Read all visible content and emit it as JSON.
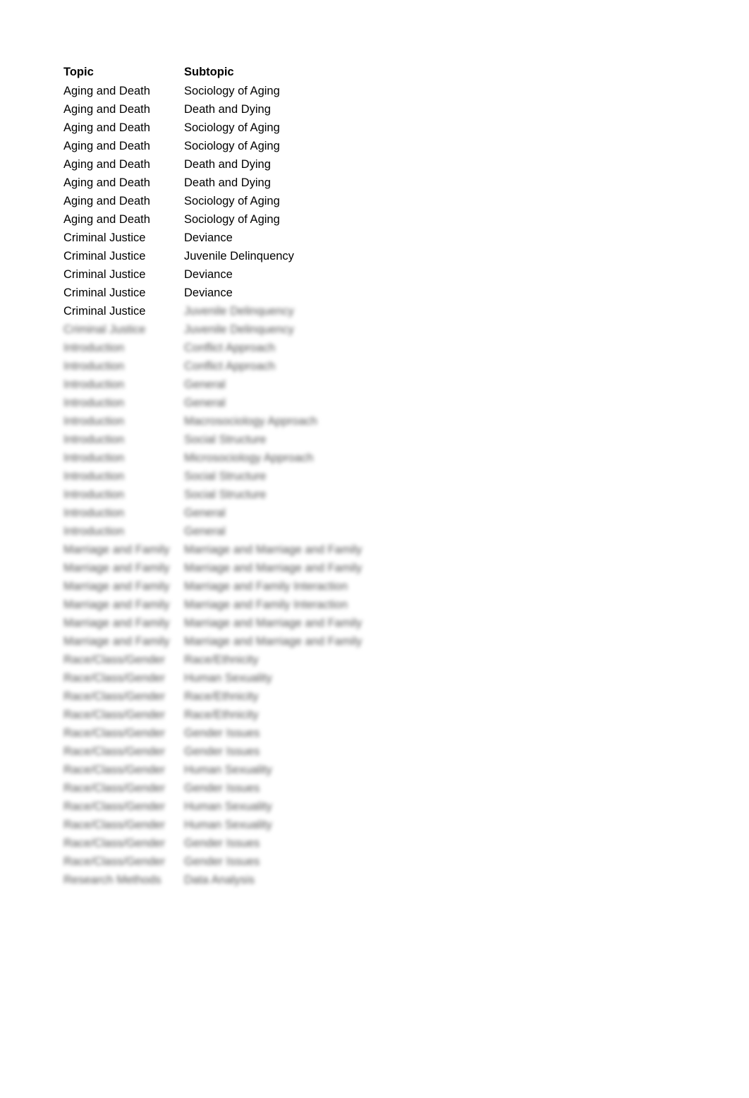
{
  "header": {
    "topic": "Topic",
    "subtopic": "Subtopic"
  },
  "rows": [
    {
      "topic": "Aging and Death",
      "subtopic": "Sociology of Aging",
      "blurred_topic": false,
      "blurred_subtopic": false
    },
    {
      "topic": "Aging and Death",
      "subtopic": "Death and Dying",
      "blurred_topic": false,
      "blurred_subtopic": false
    },
    {
      "topic": "Aging and Death",
      "subtopic": "Sociology of Aging",
      "blurred_topic": false,
      "blurred_subtopic": false
    },
    {
      "topic": "Aging and Death",
      "subtopic": "Sociology of Aging",
      "blurred_topic": false,
      "blurred_subtopic": false
    },
    {
      "topic": "Aging and Death",
      "subtopic": "Death and Dying",
      "blurred_topic": false,
      "blurred_subtopic": false
    },
    {
      "topic": "Aging and Death",
      "subtopic": "Death and Dying",
      "blurred_topic": false,
      "blurred_subtopic": false
    },
    {
      "topic": "Aging and Death",
      "subtopic": "Sociology of Aging",
      "blurred_topic": false,
      "blurred_subtopic": false
    },
    {
      "topic": "Aging and Death",
      "subtopic": "Sociology of Aging",
      "blurred_topic": false,
      "blurred_subtopic": false
    },
    {
      "topic": "Criminal Justice",
      "subtopic": "Deviance",
      "blurred_topic": false,
      "blurred_subtopic": false
    },
    {
      "topic": "Criminal Justice",
      "subtopic": "Juvenile Delinquency",
      "blurred_topic": false,
      "blurred_subtopic": false
    },
    {
      "topic": "Criminal Justice",
      "subtopic": "Deviance",
      "blurred_topic": false,
      "blurred_subtopic": false
    },
    {
      "topic": "Criminal Justice",
      "subtopic": "Deviance",
      "blurred_topic": false,
      "blurred_subtopic": false
    },
    {
      "topic": "Criminal Justice",
      "subtopic": "Juvenile Delinquency",
      "blurred_topic": false,
      "blurred_subtopic": true
    },
    {
      "topic": "Criminal Justice",
      "subtopic": "Juvenile Delinquency",
      "blurred_topic": true,
      "blurred_subtopic": true
    },
    {
      "topic": "Introduction",
      "subtopic": "Conflict Approach",
      "blurred_topic": true,
      "blurred_subtopic": true
    },
    {
      "topic": "Introduction",
      "subtopic": "Conflict Approach",
      "blurred_topic": true,
      "blurred_subtopic": true
    },
    {
      "topic": "Introduction",
      "subtopic": "General",
      "blurred_topic": true,
      "blurred_subtopic": true
    },
    {
      "topic": "Introduction",
      "subtopic": "General",
      "blurred_topic": true,
      "blurred_subtopic": true
    },
    {
      "topic": "Introduction",
      "subtopic": "Macrosociology Approach",
      "blurred_topic": true,
      "blurred_subtopic": true
    },
    {
      "topic": "Introduction",
      "subtopic": "Social Structure",
      "blurred_topic": true,
      "blurred_subtopic": true
    },
    {
      "topic": "Introduction",
      "subtopic": "Microsociology Approach",
      "blurred_topic": true,
      "blurred_subtopic": true
    },
    {
      "topic": "Introduction",
      "subtopic": "Social Structure",
      "blurred_topic": true,
      "blurred_subtopic": true
    },
    {
      "topic": "Introduction",
      "subtopic": "Social Structure",
      "blurred_topic": true,
      "blurred_subtopic": true
    },
    {
      "topic": "Introduction",
      "subtopic": "General",
      "blurred_topic": true,
      "blurred_subtopic": true
    },
    {
      "topic": "Introduction",
      "subtopic": "General",
      "blurred_topic": true,
      "blurred_subtopic": true
    },
    {
      "topic": "Marriage and Family",
      "subtopic": "Marriage and Marriage and Family",
      "blurred_topic": true,
      "blurred_subtopic": true
    },
    {
      "topic": "Marriage and Family",
      "subtopic": "Marriage and Marriage and Family",
      "blurred_topic": true,
      "blurred_subtopic": true
    },
    {
      "topic": "Marriage and Family",
      "subtopic": "Marriage and Family Interaction",
      "blurred_topic": true,
      "blurred_subtopic": true
    },
    {
      "topic": "Marriage and Family",
      "subtopic": "Marriage and Family Interaction",
      "blurred_topic": true,
      "blurred_subtopic": true
    },
    {
      "topic": "Marriage and Family",
      "subtopic": "Marriage and Marriage and Family",
      "blurred_topic": true,
      "blurred_subtopic": true
    },
    {
      "topic": "Marriage and Family",
      "subtopic": "Marriage and Marriage and Family",
      "blurred_topic": true,
      "blurred_subtopic": true
    },
    {
      "topic": "Race/Class/Gender",
      "subtopic": "Race/Ethnicity",
      "blurred_topic": true,
      "blurred_subtopic": true
    },
    {
      "topic": "Race/Class/Gender",
      "subtopic": "Human Sexuality",
      "blurred_topic": true,
      "blurred_subtopic": true
    },
    {
      "topic": "Race/Class/Gender",
      "subtopic": "Race/Ethnicity",
      "blurred_topic": true,
      "blurred_subtopic": true
    },
    {
      "topic": "Race/Class/Gender",
      "subtopic": "Race/Ethnicity",
      "blurred_topic": true,
      "blurred_subtopic": true
    },
    {
      "topic": "Race/Class/Gender",
      "subtopic": "Gender Issues",
      "blurred_topic": true,
      "blurred_subtopic": true
    },
    {
      "topic": "Race/Class/Gender",
      "subtopic": "Gender Issues",
      "blurred_topic": true,
      "blurred_subtopic": true
    },
    {
      "topic": "Race/Class/Gender",
      "subtopic": "Human Sexuality",
      "blurred_topic": true,
      "blurred_subtopic": true
    },
    {
      "topic": "Race/Class/Gender",
      "subtopic": "Gender Issues",
      "blurred_topic": true,
      "blurred_subtopic": true
    },
    {
      "topic": "Race/Class/Gender",
      "subtopic": "Human Sexuality",
      "blurred_topic": true,
      "blurred_subtopic": true
    },
    {
      "topic": "Race/Class/Gender",
      "subtopic": "Human Sexuality",
      "blurred_topic": true,
      "blurred_subtopic": true
    },
    {
      "topic": "Race/Class/Gender",
      "subtopic": "Gender Issues",
      "blurred_topic": true,
      "blurred_subtopic": true
    },
    {
      "topic": "Race/Class/Gender",
      "subtopic": "Gender Issues",
      "blurred_topic": true,
      "blurred_subtopic": true
    },
    {
      "topic": "Research Methods",
      "subtopic": "Data Analysis",
      "blurred_topic": true,
      "blurred_subtopic": true
    }
  ]
}
